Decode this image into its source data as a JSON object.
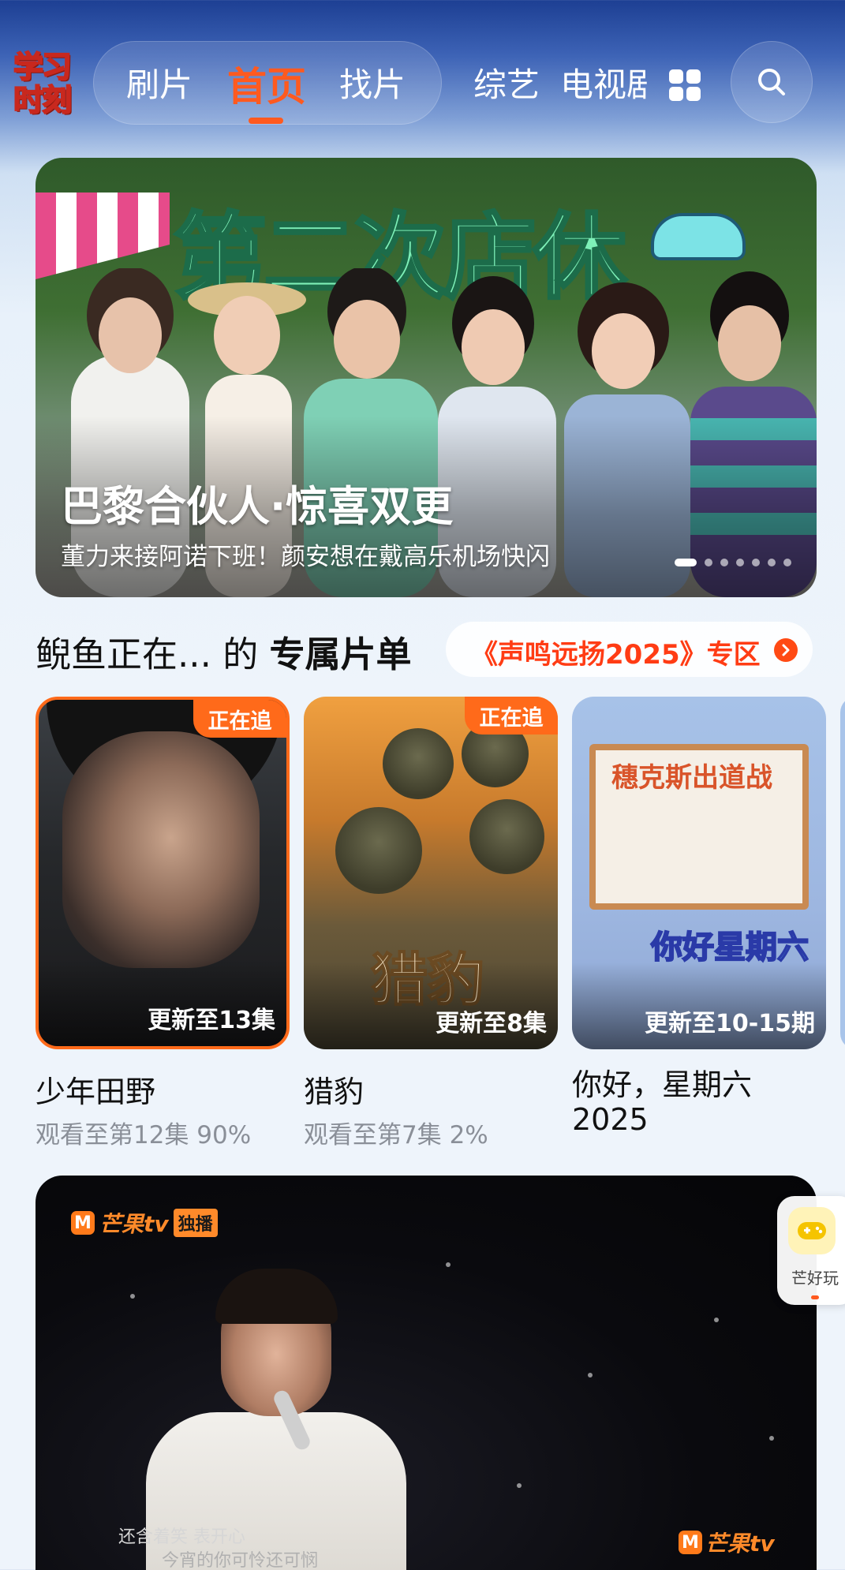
{
  "header": {
    "logo_line1": "学习",
    "logo_line2": "时刻",
    "tabs": [
      {
        "label": "刷片",
        "active": false
      },
      {
        "label": "首页",
        "active": true
      },
      {
        "label": "找片",
        "active": false
      },
      {
        "label": "综艺",
        "active": false
      },
      {
        "label": "电视剧",
        "active": false
      }
    ],
    "grid_icon": "grid-icon",
    "search_icon": "search-icon",
    "accent_color": "#ff5a1f"
  },
  "banner": {
    "art_title": "第二次店休",
    "title": "巴黎合伙人·惊喜双更",
    "subtitle": "董力来接阿诺下班！颜安想在戴高乐机场快闪",
    "slide_count": 7,
    "active_slide": 1
  },
  "section": {
    "title_prefix": "鲵鱼正在... 的",
    "title_bold": "专属片单",
    "promo": "《声鸣远扬2025》专区",
    "promo_color": "#ff3c14"
  },
  "cards": [
    {
      "badge": "正在追",
      "update": "更新至13集",
      "title": "少年田野",
      "progress": "观看至第12集 90%"
    },
    {
      "badge": "正在追",
      "update": "更新至8集",
      "title": "猎豹",
      "progress": "观看至第7集 2%",
      "art_text": "猎豹"
    },
    {
      "badge": "",
      "update": "更新至10-15期",
      "title": "你好，星期六2025",
      "progress": "",
      "art_board_title": "穗克斯出道战",
      "art_logo": "你好星期六"
    }
  ],
  "video": {
    "brand": "芒果tv",
    "brand_tag": "独播",
    "lyric_line1": "还含着笑 表开心",
    "lyric_line2": "今宵的你可怜还可悯",
    "watermark": "芒果tv"
  },
  "float_widget": {
    "label": "芒好玩",
    "icon": "gamepad-icon"
  }
}
